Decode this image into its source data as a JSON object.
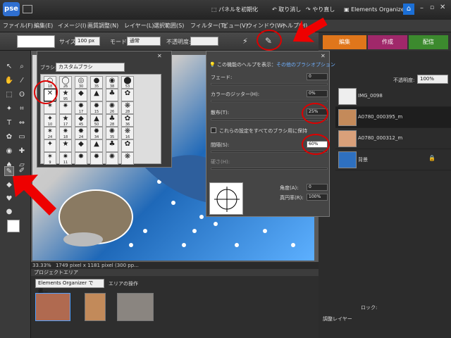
{
  "app": {
    "logo": "pse"
  },
  "titlebar": {
    "reset_panels": "パネルを初期化",
    "undo": "取り消し",
    "redo": "やり直し",
    "organizer": "Elements Organizer"
  },
  "menu": [
    "ファイル(F)",
    "編集(E)",
    "イメージ(I)",
    "画質調整(N)",
    "レイヤー(L)",
    "選択範囲(S)",
    "フィルター(T)",
    "ビュー(V)",
    "ウィンドウ(W)",
    "ヘルプ(H)"
  ],
  "options": {
    "size_label": "サイズ:",
    "size_value": "100 px",
    "mode_label": "モード:",
    "mode_value": "通常",
    "opacity_label": "不透明度:"
  },
  "tabs": {
    "edit": "編集",
    "create": "作成",
    "share": "配信"
  },
  "brush_panel": {
    "label": "ブラシ:",
    "value": "カスタムブラシ",
    "rows": [
      [
        "18",
        "26",
        "30",
        "35",
        "38",
        "53"
      ],
      [
        "",
        "95",
        "",
        "",
        "",
        ""
      ],
      [
        "",
        "",
        "17",
        "15",
        "26",
        "28"
      ],
      [
        "10",
        "17",
        "45",
        "50",
        "28",
        "36"
      ],
      [
        "24",
        "18",
        "24",
        "34",
        "35",
        "16"
      ],
      [
        "",
        "",
        "",
        "",
        "",
        ""
      ],
      [
        "9",
        "11",
        "",
        "",
        "",
        ""
      ]
    ]
  },
  "help_panel": {
    "help_text": "この機能のヘルプを表示：",
    "help_link": "その他のブラシオプション",
    "fade_label": "フェード:",
    "fade_value": "0",
    "jitter_label": "カラーのジッター(H):",
    "jitter_value": "0%",
    "scatter_label": "散布(T):",
    "scatter_value": "25%",
    "keep_label": "これらの設定をすべてのブラシ用に保持",
    "spacing_label": "間隔(S):",
    "spacing_value": "60%",
    "hardness_label": "硬さ(H):",
    "angle_label": "角度(A):",
    "angle_value": "0",
    "roundness_label": "真円率(R):",
    "roundness_value": "100%"
  },
  "layers": {
    "opacity_label": "不透明度:",
    "opacity_value": "100%",
    "items": [
      "IMG_0098",
      "A0780_000395_m",
      "A0780_000312_m",
      "背景"
    ],
    "lock_label": "ロック:",
    "adjust_label": "調整レイヤー"
  },
  "status": {
    "zoom": "33.33%",
    "info": "1749 pixel x 1181 pixel (300 pp..."
  },
  "project": {
    "title": "プロジェクトエリア",
    "source": "Elements Organizer で選...",
    "ops": "エリアの操作"
  },
  "colors": {
    "accent_red": "#dd0000",
    "edit_tab": "#e0761b",
    "create_tab": "#a0286a",
    "share_tab": "#3c8a2e"
  }
}
